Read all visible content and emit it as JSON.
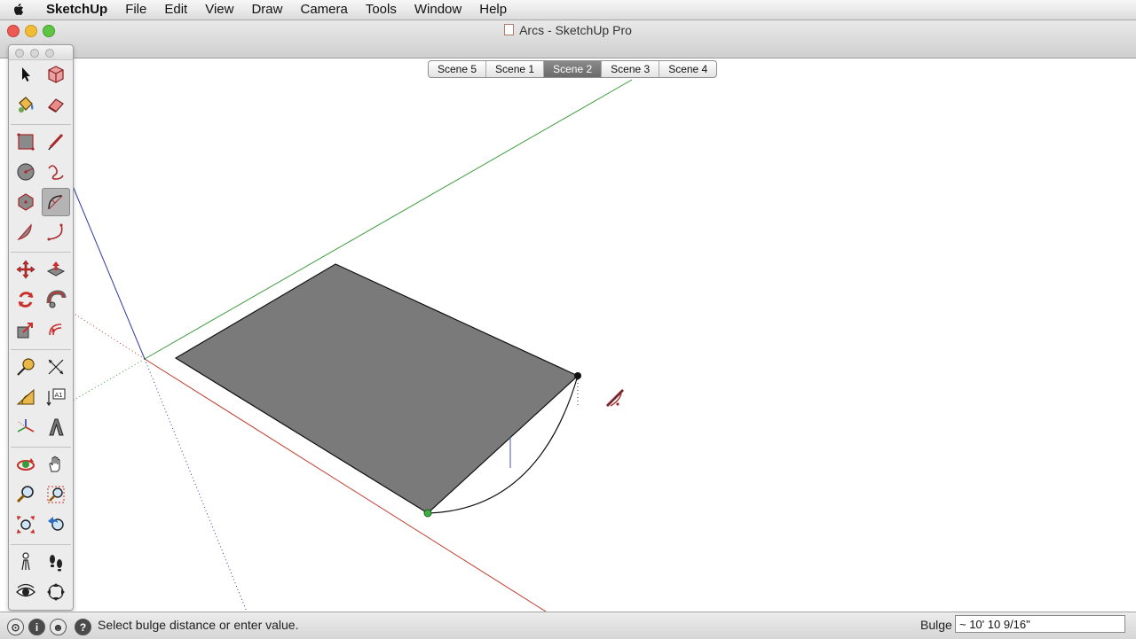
{
  "menubar": {
    "app_name": "SketchUp",
    "items": [
      "File",
      "Edit",
      "View",
      "Draw",
      "Camera",
      "Tools",
      "Window",
      "Help"
    ]
  },
  "window": {
    "title": "Arcs - SketchUp Pro"
  },
  "scenes": {
    "tabs": [
      "Scene 5",
      "Scene 1",
      "Scene 2",
      "Scene 3",
      "Scene 4"
    ],
    "active": "Scene 2"
  },
  "toolbar": {
    "tools": [
      "select-icon",
      "make-component-icon",
      "paint-bucket-icon",
      "eraser-icon",
      "rectangle-icon",
      "line-icon",
      "circle-icon",
      "freehand-icon",
      "polygon-icon",
      "arc-icon",
      "pie-icon",
      "three-point-arc-icon",
      "move-icon",
      "push-pull-icon",
      "rotate-icon",
      "follow-me-icon",
      "scale-icon",
      "offset-icon",
      "tape-measure-icon",
      "dimension-icon",
      "protractor-icon",
      "text-icon",
      "axes-icon",
      "3d-text-icon",
      "orbit-icon",
      "pan-icon",
      "zoom-icon",
      "zoom-window-icon",
      "zoom-extents-icon",
      "previous-view-icon",
      "position-camera-icon",
      "walk-icon",
      "look-around-icon",
      "section-plane-icon"
    ],
    "selected_tool": "arc-icon"
  },
  "statusbar": {
    "message": "Select bulge distance or enter value.",
    "measurement_label": "Bulge",
    "measurement_value": "~ 10' 10 9/16\""
  },
  "colors": {
    "axis_red": "#c0392b",
    "axis_green": "#3a9b3a",
    "axis_blue": "#2b3aa0",
    "face_gray": "#7a7a7a",
    "active_tab": "#7a7a7a"
  }
}
